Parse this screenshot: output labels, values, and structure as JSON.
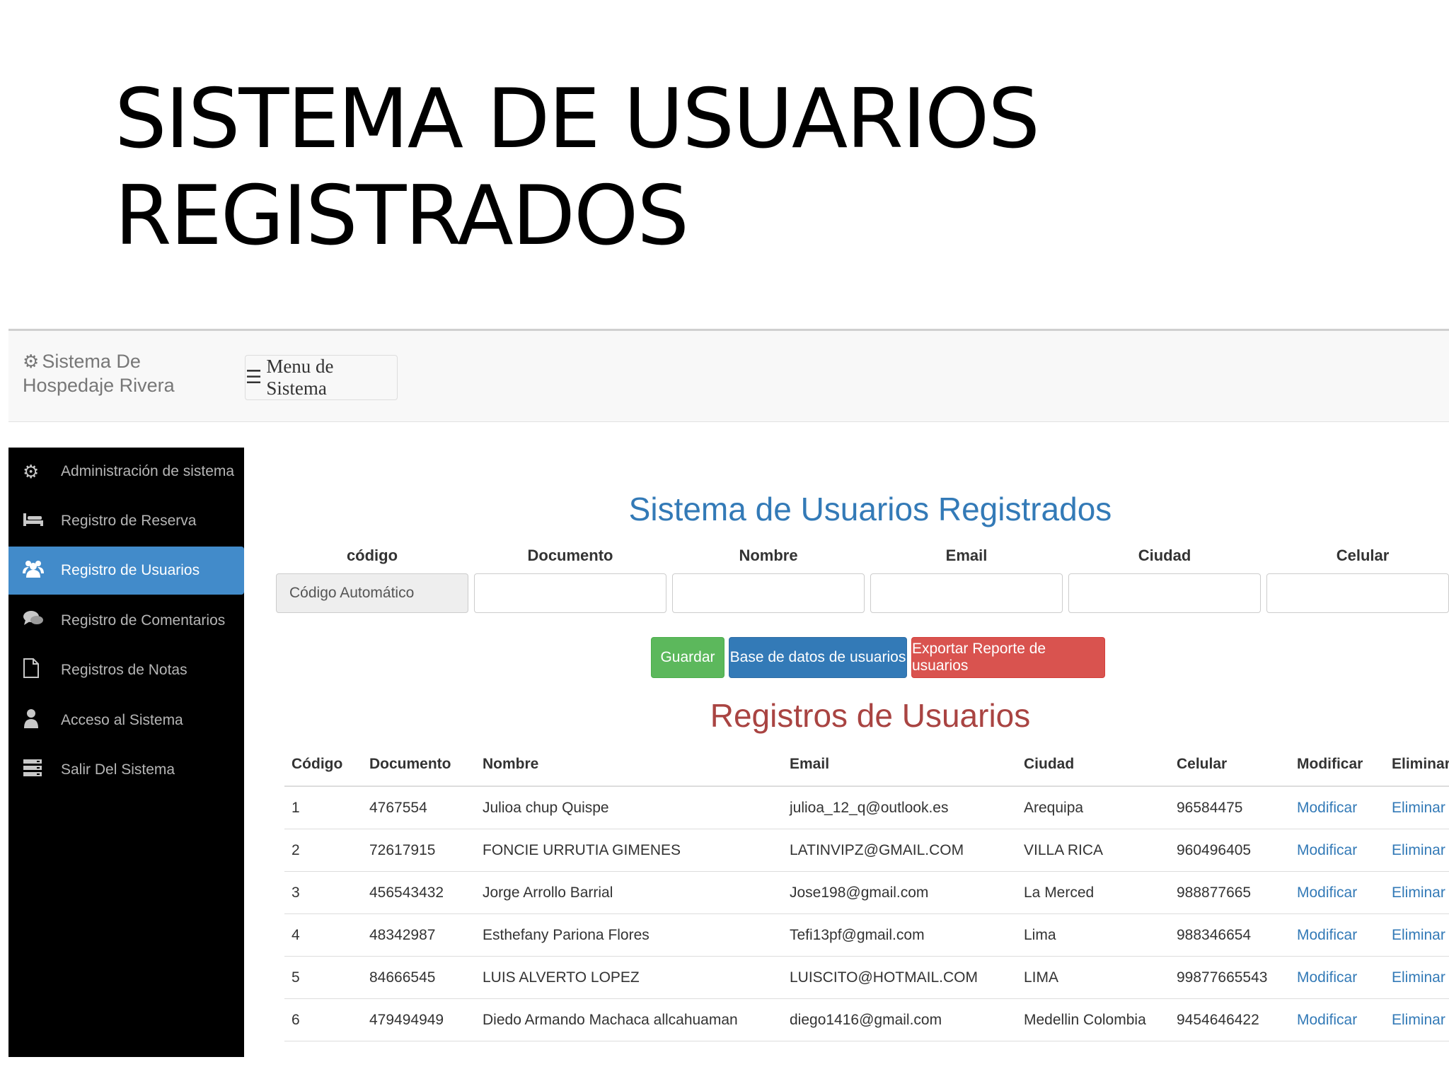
{
  "slide": {
    "title_line1": "SISTEMA DE USUARIOS",
    "title_line2": "REGISTRADOS"
  },
  "navbar": {
    "brand_icon": "gear-icon",
    "brand": "Sistema De Hospedaje Rivera",
    "menu_icon": "hamburger-icon",
    "menu_button": "Menu de Sistema"
  },
  "sidebar": {
    "items": [
      {
        "icon": "gear-icon",
        "label": "Administración de sistema"
      },
      {
        "icon": "bed-icon",
        "label": "Registro de Reserva"
      },
      {
        "icon": "users-icon",
        "label": "Registro de Usuarios"
      },
      {
        "icon": "comments-icon",
        "label": "Registro de Comentarios"
      },
      {
        "icon": "file-icon",
        "label": "Registros de Notas"
      },
      {
        "icon": "user-icon",
        "label": "Acceso al Sistema"
      },
      {
        "icon": "server-icon",
        "label": "Salir Del Sistema"
      }
    ],
    "active_index": 2
  },
  "form": {
    "heading": "Sistema de Usuarios Registrados",
    "labels": [
      "código",
      "Documento",
      "Nombre",
      "Email",
      "Ciudad",
      "Celular"
    ],
    "code_value": "Código Automático",
    "buttons": {
      "save": "Guardar",
      "database": "Base de datos de usuarios",
      "export": "Exportar Reporte de usuarios"
    },
    "colors": {
      "save": "#5cb85c",
      "database": "#337ab7",
      "export": "#d9534f"
    }
  },
  "records": {
    "heading": "Registros de Usuarios",
    "columns": [
      "Código",
      "Documento",
      "Nombre",
      "Email",
      "Ciudad",
      "Celular",
      "Modificar",
      "Eliminar"
    ],
    "rows": [
      [
        "1",
        "4767554",
        "Julioa chup Quispe",
        "julioa_12_q@outlook.es",
        "Arequipa",
        "96584475",
        "Modificar",
        "Eliminar"
      ],
      [
        "2",
        "72617915",
        "FONCIE URRUTIA GIMENES",
        "LATINVIPZ@GMAIL.COM",
        "VILLA RICA",
        "960496405",
        "Modificar",
        "Eliminar"
      ],
      [
        "3",
        "456543432",
        "Jorge Arrollo Barrial",
        "Jose198@gmail.com",
        "La Merced",
        "988877665",
        "Modificar",
        "Eliminar"
      ],
      [
        "4",
        "48342987",
        "Esthefany Pariona Flores",
        "Tefi13pf@gmail.com",
        "Lima",
        "988346654",
        "Modificar",
        "Eliminar"
      ],
      [
        "5",
        "84666545",
        "LUIS ALVERTO LOPEZ",
        "LUISCITO@HOTMAIL.COM",
        "LIMA",
        "99877665543",
        "Modificar",
        "Eliminar"
      ],
      [
        "6",
        "479494949",
        "Diedo Armando Machaca allcahuaman",
        "diego1416@gmail.com",
        "Medellin Colombia",
        "9454646422",
        "Modificar",
        "Eliminar"
      ]
    ]
  }
}
